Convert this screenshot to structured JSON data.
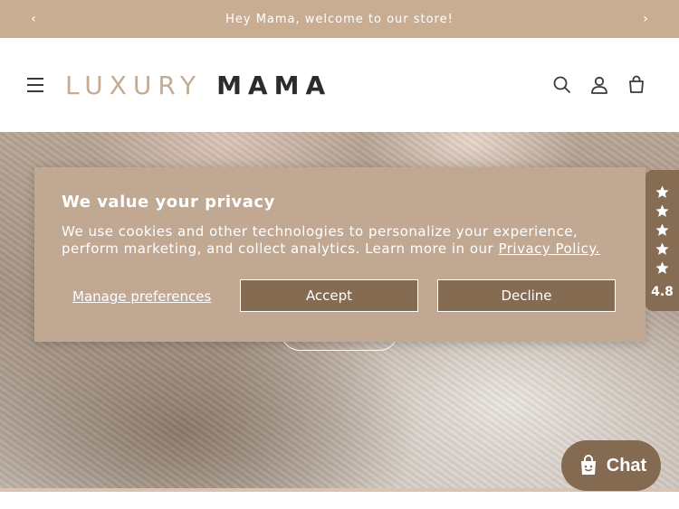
{
  "announcement": {
    "text": "Hey Mama, welcome to our store!"
  },
  "header": {
    "logo_light": "LUXURY",
    "logo_dark": "MAMA"
  },
  "icons": {
    "menu": "hamburger-icon",
    "search": "search-icon",
    "account": "account-icon",
    "cart": "cart-icon",
    "prev": "chevron-left-icon",
    "next": "chevron-right-icon"
  },
  "cookie_banner": {
    "title": "We value your privacy",
    "body": "We use cookies and other technologies to personalize your experience, perform marketing, and collect analytics. Learn more in our ",
    "link": "Privacy Policy.",
    "manage_label": "Manage preferences",
    "accept_label": "Accept",
    "decline_label": "Decline"
  },
  "reviews": {
    "stars": 5,
    "score": "4.8"
  },
  "chat": {
    "label": "Chat"
  },
  "colors": {
    "brand_tan": "#c8ad93",
    "button_brown": "#846b51",
    "logo_dark": "#2c2c2c"
  }
}
